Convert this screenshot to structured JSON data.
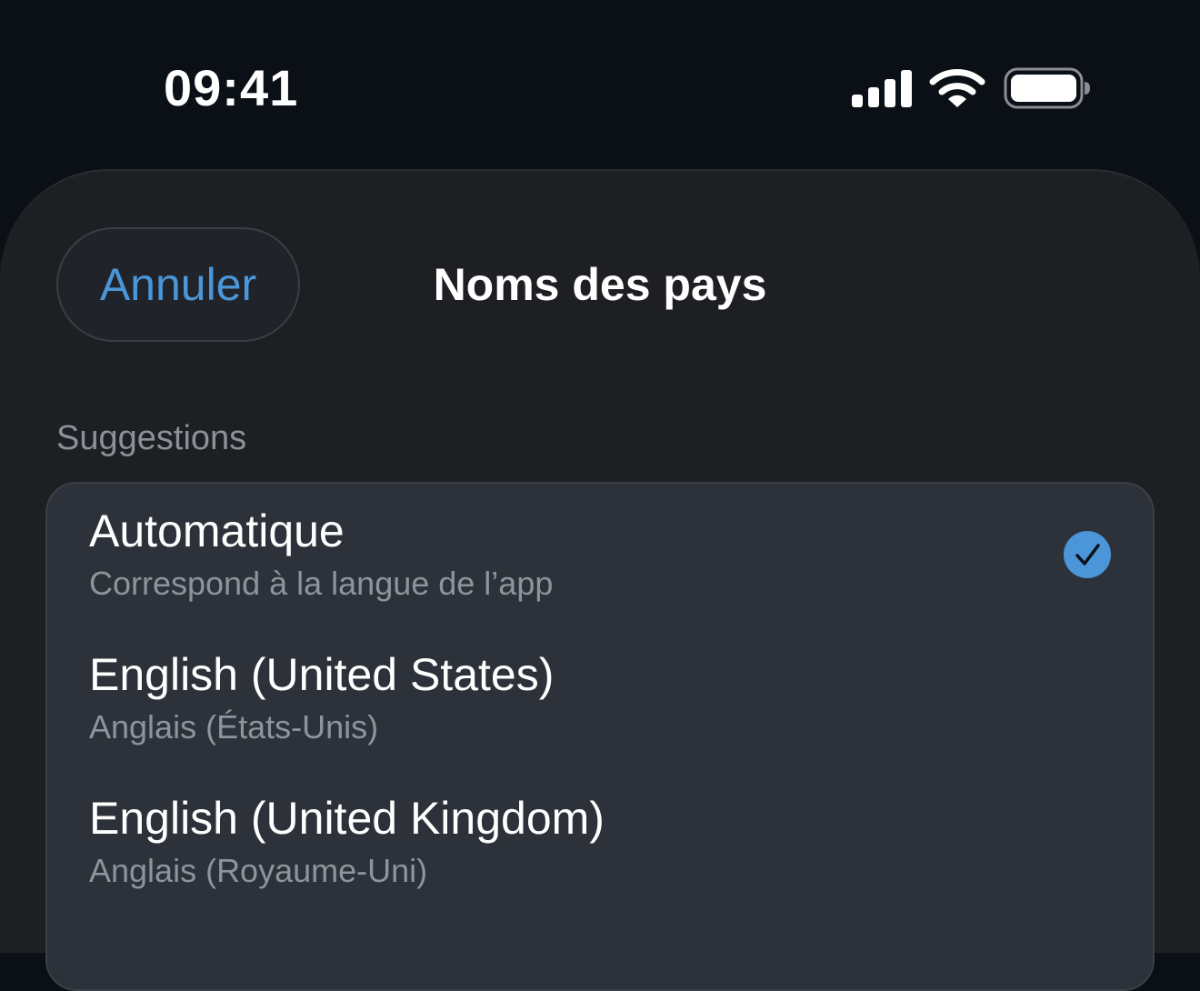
{
  "status_bar": {
    "time": "09:41"
  },
  "icons": {
    "signal": "cellular-signal-icon",
    "wifi": "wifi-icon",
    "battery": "battery-icon",
    "check": "checkmark-circle-icon"
  },
  "colors": {
    "accent": "#4a96d8",
    "background": "#0b1016",
    "sheet": "#1d1f23",
    "card": "#2d323a"
  },
  "sheet": {
    "cancel_label": "Annuler",
    "title": "Noms des pays",
    "section_header": "Suggestions",
    "items": [
      {
        "title": "Automatique",
        "subtitle": "Correspond à la langue de l’app",
        "selected": true
      },
      {
        "title": "English (United States)",
        "subtitle": "Anglais (États-Unis)",
        "selected": false
      },
      {
        "title": "English (United Kingdom)",
        "subtitle": "Anglais (Royaume-Uni)",
        "selected": false
      }
    ]
  }
}
